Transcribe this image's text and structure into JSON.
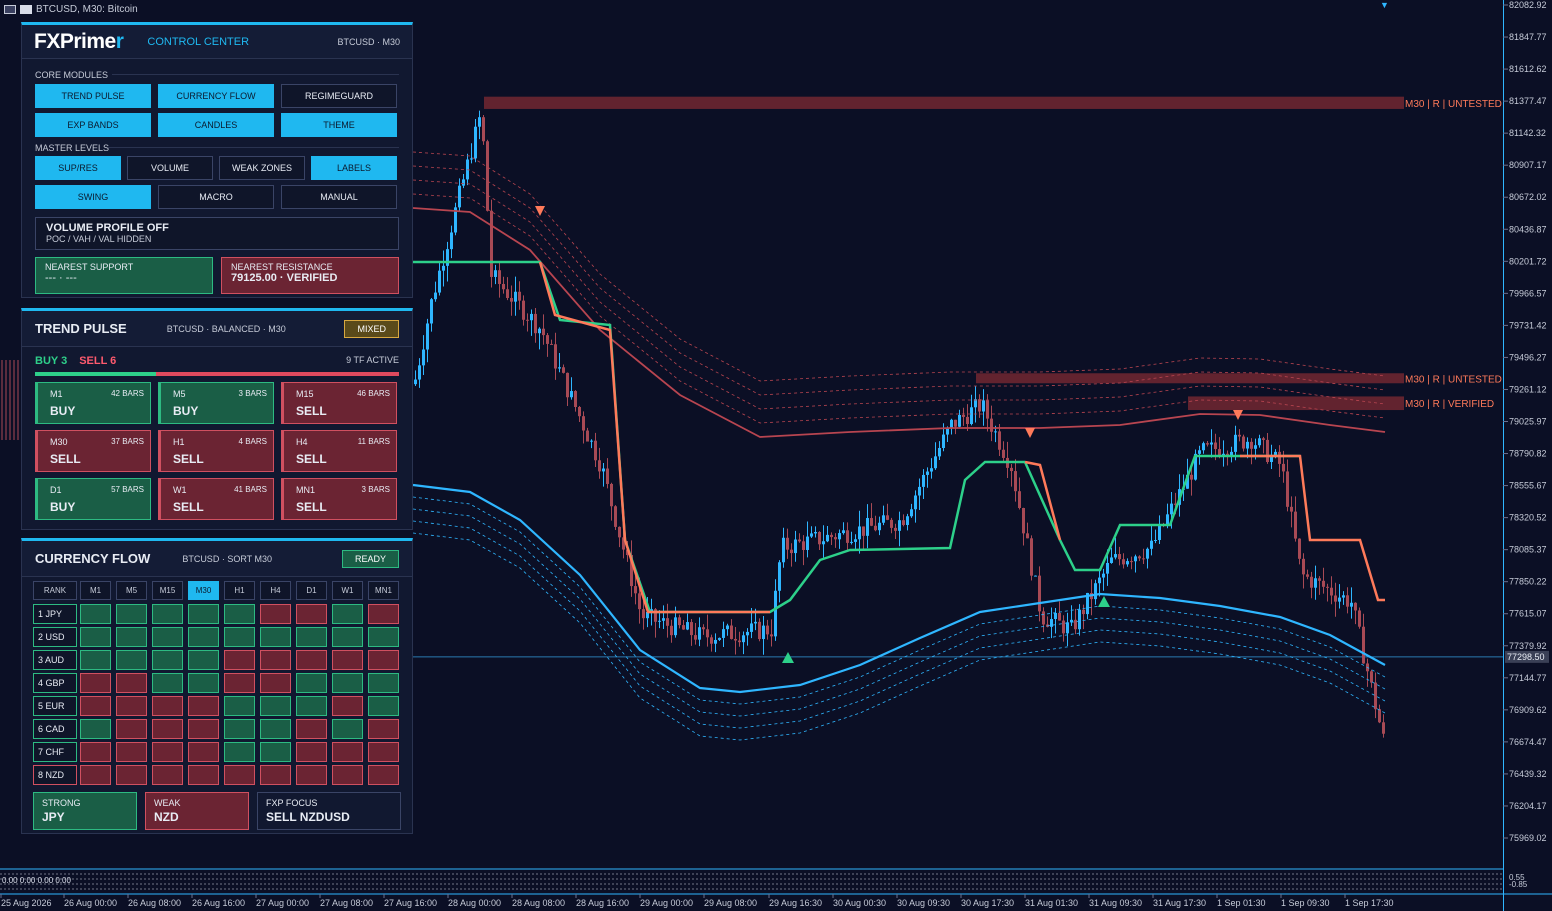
{
  "window": {
    "title": "BTCUSD, M30:  Bitcoin"
  },
  "chart_data": {
    "type": "line",
    "title": "BTCUSD, M30:  Bitcoin",
    "y_ticks": [
      "82082.92",
      "81847.77",
      "81612.62",
      "81377.47",
      "81142.32",
      "80907.17",
      "80672.02",
      "80436.87",
      "80201.72",
      "79966.57",
      "79731.42",
      "79496.27",
      "79261.12",
      "79025.97",
      "78790.82",
      "78555.67",
      "78320.52",
      "78085.37",
      "77850.22",
      "77615.07",
      "77379.92",
      "77144.77",
      "76909.62",
      "76674.47",
      "76439.32",
      "76204.17",
      "75969.02"
    ],
    "y_range": [
      75969.02,
      82082.92
    ],
    "current_price": "77298.50",
    "x_ticks": [
      "25 Aug 2026",
      "26 Aug 00:00",
      "26 Aug 08:00",
      "26 Aug 16:00",
      "27 Aug 00:00",
      "27 Aug 08:00",
      "27 Aug 16:00",
      "28 Aug 00:00",
      "28 Aug 08:00",
      "28 Aug 16:00",
      "29 Aug 00:00",
      "29 Aug 08:00",
      "29 Aug 16:30",
      "30 Aug 00:30",
      "30 Aug 09:30",
      "30 Aug 17:30",
      "31 Aug 01:30",
      "31 Aug 09:30",
      "31 Aug 17:30",
      "1 Sep 01:30",
      "1 Sep 09:30",
      "1 Sep 17:30"
    ],
    "zones": [
      {
        "label": "M30 | R | UNTESTED",
        "low": 81320,
        "high": 81410
      },
      {
        "label": "M30 | R | UNTESTED",
        "low": 79320,
        "high": 79380
      },
      {
        "label": "M30 | R | VERIFIED",
        "low": 79110,
        "high": 79210
      }
    ],
    "subwindow_ticks": [
      "0.55",
      "-0.85"
    ],
    "subwindow_text": "0.00 0.00 0.00 0.00",
    "colors": {
      "bull": "#2fb6ff",
      "bear": "#a84a55",
      "support": "#2dd08a",
      "resistance": "#ff7a5a",
      "band": "#2fb6ff",
      "grid": "#1a2038"
    }
  },
  "control": {
    "logo_main": "FXPrime",
    "logo_tail": "r",
    "title": "CONTROL CENTER",
    "symbol": "BTCUSD · M30",
    "core_label": "CORE MODULES",
    "core": [
      {
        "label": "TREND PULSE",
        "on": true
      },
      {
        "label": "CURRENCY FLOW",
        "on": true
      },
      {
        "label": "REGIMEGUARD",
        "on": false
      },
      {
        "label": "EXP BANDS",
        "on": true
      },
      {
        "label": "CANDLES",
        "on": true
      },
      {
        "label": "THEME",
        "on": true
      }
    ],
    "master_label": "MASTER LEVELS",
    "master": [
      {
        "label": "SUP/RES",
        "on": true
      },
      {
        "label": "VOLUME",
        "on": false
      },
      {
        "label": "WEAK ZONES",
        "on": false
      },
      {
        "label": "LABELS",
        "on": true
      }
    ],
    "master2": [
      {
        "label": "SWING",
        "on": true
      },
      {
        "label": "MACRO",
        "on": false
      },
      {
        "label": "MANUAL",
        "on": false
      }
    ],
    "vp_title": "VOLUME PROFILE OFF",
    "vp_sub": "POC / VAH / VAL HIDDEN",
    "support_label": "NEAREST SUPPORT",
    "support_value": "---  ·  ---",
    "resistance_label": "NEAREST RESISTANCE",
    "resistance_value": "79125.00  ·  VERIFIED"
  },
  "trend": {
    "title": "TREND PULSE",
    "sub": "BTCUSD · BALANCED · M30",
    "badge": "MIXED",
    "buy": "BUY 3",
    "sell": "SELL 6",
    "tf_active": "9 TF ACTIVE",
    "buy_fraction": 0.333,
    "cards": [
      {
        "tf": "M1",
        "bars": "42 BARS",
        "sig": "BUY"
      },
      {
        "tf": "M5",
        "bars": "3 BARS",
        "sig": "BUY"
      },
      {
        "tf": "M15",
        "bars": "46 BARS",
        "sig": "SELL"
      },
      {
        "tf": "M30",
        "bars": "37 BARS",
        "sig": "SELL"
      },
      {
        "tf": "H1",
        "bars": "4 BARS",
        "sig": "SELL"
      },
      {
        "tf": "H4",
        "bars": "11 BARS",
        "sig": "SELL"
      },
      {
        "tf": "D1",
        "bars": "57 BARS",
        "sig": "BUY"
      },
      {
        "tf": "W1",
        "bars": "41 BARS",
        "sig": "SELL"
      },
      {
        "tf": "MN1",
        "bars": "3 BARS",
        "sig": "SELL"
      }
    ]
  },
  "flow": {
    "title": "CURRENCY FLOW",
    "sub": "BTCUSD · SORT M30",
    "badge": "READY",
    "rank_label": "RANK",
    "tfs": [
      "M1",
      "M5",
      "M15",
      "M30",
      "H1",
      "H4",
      "D1",
      "W1",
      "MN1"
    ],
    "active_tf": "M30",
    "rows": [
      {
        "name": "1 JPY",
        "s": "g",
        "cells": "gggggrrgr"
      },
      {
        "name": "2 USD",
        "s": "g",
        "cells": "ggggggggg"
      },
      {
        "name": "3 AUD",
        "s": "g",
        "cells": "ggggrrrrr"
      },
      {
        "name": "4 GBP",
        "s": "g",
        "cells": "rrggrrggg"
      },
      {
        "name": "5 EUR",
        "s": "g",
        "cells": "rrrrgggrg"
      },
      {
        "name": "6 CAD",
        "s": "g",
        "cells": "grrrggrgr"
      },
      {
        "name": "7 CHF",
        "s": "g",
        "cells": "rrrrggrrr"
      },
      {
        "name": "8 NZD",
        "s": "r",
        "cells": "rrrrrrrrr"
      }
    ],
    "strong_label": "STRONG",
    "strong": "JPY",
    "weak_label": "WEAK",
    "weak": "NZD",
    "focus_label": "FXP FOCUS",
    "focus": "SELL NZDUSD"
  }
}
